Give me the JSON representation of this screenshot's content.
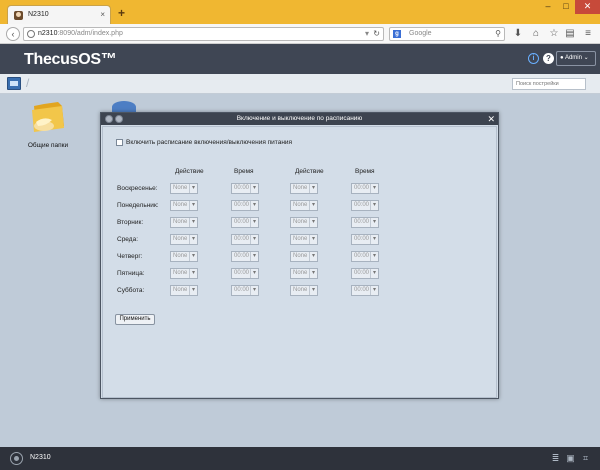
{
  "browser": {
    "tab_title": "N2310",
    "tab_close": "×",
    "new_tab": "+",
    "url_host": "n2310",
    "url_path": ":8090/adm/index.php",
    "search_engine": "g",
    "search_placeholder": "Google",
    "window_controls": {
      "minimize": "–",
      "maximize": "□",
      "close": "✕"
    }
  },
  "app": {
    "logo": "ThecusOS™",
    "user_menu": "Admin",
    "search_placeholder": "Поиск пострейки",
    "desktop_icons": [
      {
        "label": "Общие папки",
        "icon": "shared-folder-icon"
      }
    ],
    "accent_color": "#3d4450"
  },
  "modal": {
    "title": "Включение и выключение по расписанию",
    "close": "✕",
    "enable_checkbox_label": "Включить расписание включения/выключения питания",
    "enable_checked": false,
    "columns": [
      "Действие",
      "Время",
      "Действие",
      "Время"
    ],
    "days": [
      {
        "label": "Воскресенье:",
        "action1": "None",
        "time1": "00:00",
        "action2": "None",
        "time2": "00:00"
      },
      {
        "label": "Понедельник:",
        "action1": "None",
        "time1": "00:00",
        "action2": "None",
        "time2": "00:00"
      },
      {
        "label": "Вторник:",
        "action1": "None",
        "time1": "00:00",
        "action2": "None",
        "time2": "00:00"
      },
      {
        "label": "Среда:",
        "action1": "None",
        "time1": "00:00",
        "action2": "None",
        "time2": "00:00"
      },
      {
        "label": "Четверг:",
        "action1": "None",
        "time1": "00:00",
        "action2": "None",
        "time2": "00:00"
      },
      {
        "label": "Пятница:",
        "action1": "None",
        "time1": "00:00",
        "action2": "None",
        "time2": "00:00"
      },
      {
        "label": "Суббота:",
        "action1": "None",
        "time1": "00:00",
        "action2": "None",
        "time2": "00:00"
      }
    ],
    "apply_label": "Применить"
  },
  "taskbar": {
    "device_name": "N2310",
    "icons": [
      "storage-icon",
      "disk-icon",
      "network-icon"
    ]
  }
}
